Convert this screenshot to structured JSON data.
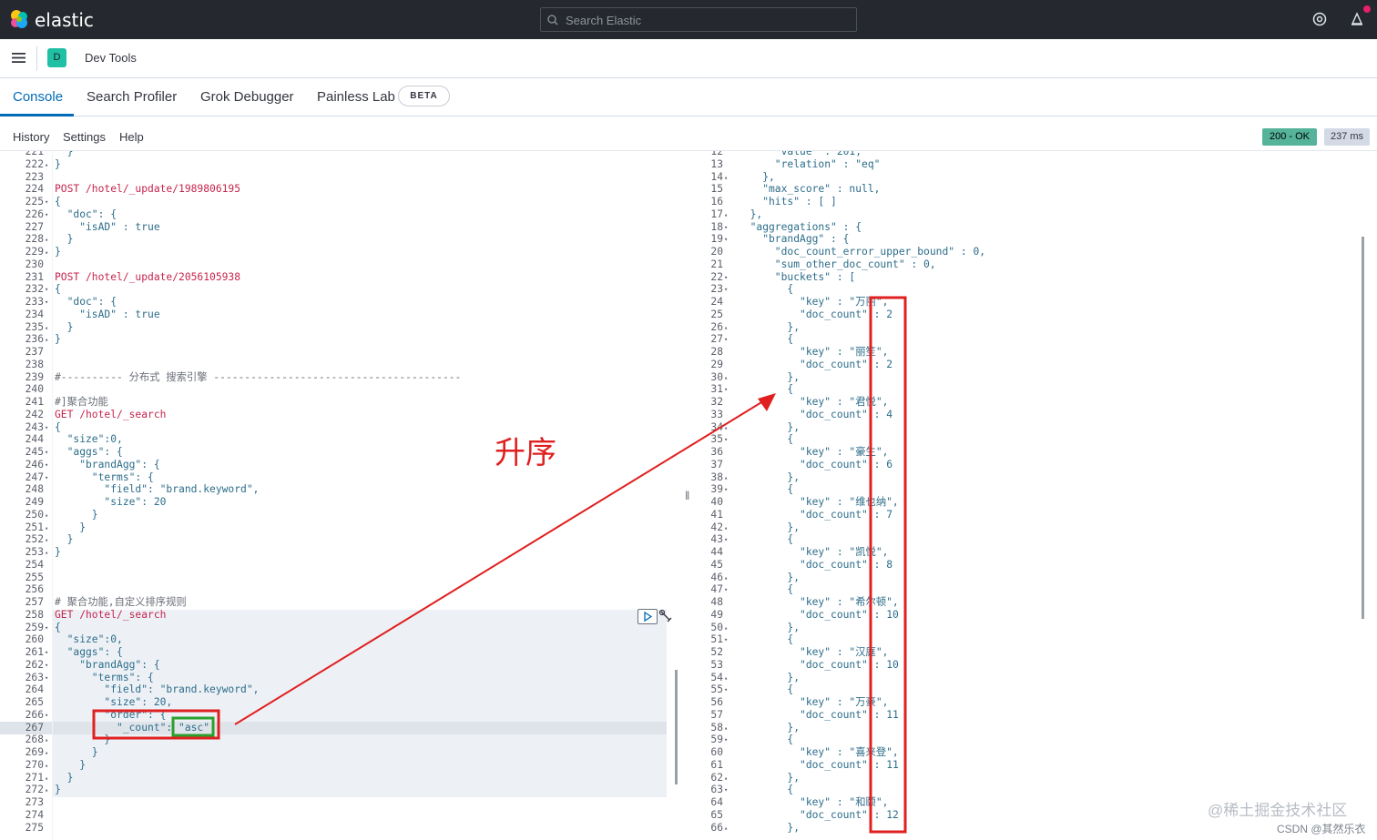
{
  "header": {
    "brand": "elastic",
    "search_placeholder": "Search Elastic"
  },
  "breadcrumb": {
    "space_initial": "D",
    "title": "Dev Tools"
  },
  "tabs": [
    {
      "label": "Console"
    },
    {
      "label": "Search Profiler"
    },
    {
      "label": "Grok Debugger"
    },
    {
      "label": "Painless Lab"
    }
  ],
  "beta": "BETA",
  "subnav": {
    "history": "History",
    "settings": "Settings",
    "help": "Help"
  },
  "response": {
    "status": "200 - OK",
    "time": "237 ms"
  },
  "annotation": {
    "text": "升序"
  },
  "watermark": {
    "main": "@稀土掘金技术社区",
    "sub": "CSDN @其然乐衣"
  },
  "colors": {
    "topbar": "#25282f",
    "accent": "#006bb8",
    "status_ok": "#54b399",
    "annotation_red": "#e02020",
    "annotation_green": "#2ca02c"
  },
  "editor": {
    "lines": [
      {
        "n": "221",
        "f": "",
        "t": "  }"
      },
      {
        "n": "222",
        "f": "▴",
        "t": "}"
      },
      {
        "n": "223",
        "f": "",
        "t": ""
      },
      {
        "n": "224",
        "f": "",
        "t": "POST /hotel/_update/1989806195"
      },
      {
        "n": "225",
        "f": "▾",
        "t": "{"
      },
      {
        "n": "226",
        "f": "▾",
        "t": "  \"doc\": {"
      },
      {
        "n": "227",
        "f": "",
        "t": "    \"isAD\" : true"
      },
      {
        "n": "228",
        "f": "▴",
        "t": "  }"
      },
      {
        "n": "229",
        "f": "▴",
        "t": "}"
      },
      {
        "n": "230",
        "f": "",
        "t": ""
      },
      {
        "n": "231",
        "f": "",
        "t": "POST /hotel/_update/2056105938"
      },
      {
        "n": "232",
        "f": "▾",
        "t": "{"
      },
      {
        "n": "233",
        "f": "▾",
        "t": "  \"doc\": {"
      },
      {
        "n": "234",
        "f": "",
        "t": "    \"isAD\" : true"
      },
      {
        "n": "235",
        "f": "▴",
        "t": "  }"
      },
      {
        "n": "236",
        "f": "▴",
        "t": "}"
      },
      {
        "n": "237",
        "f": "",
        "t": ""
      },
      {
        "n": "238",
        "f": "",
        "t": ""
      },
      {
        "n": "239",
        "f": "",
        "t": "#---------- 分布式 搜索引擎 ----------------------------------------"
      },
      {
        "n": "240",
        "f": "",
        "t": ""
      },
      {
        "n": "241",
        "f": "",
        "t": "#]聚合功能"
      },
      {
        "n": "242",
        "f": "",
        "t": "GET /hotel/_search"
      },
      {
        "n": "243",
        "f": "▾",
        "t": "{"
      },
      {
        "n": "244",
        "f": "",
        "t": "  \"size\":0,"
      },
      {
        "n": "245",
        "f": "▾",
        "t": "  \"aggs\": {"
      },
      {
        "n": "246",
        "f": "▾",
        "t": "    \"brandAgg\": {"
      },
      {
        "n": "247",
        "f": "▾",
        "t": "      \"terms\": {"
      },
      {
        "n": "248",
        "f": "",
        "t": "        \"field\": \"brand.keyword\","
      },
      {
        "n": "249",
        "f": "",
        "t": "        \"size\": 20"
      },
      {
        "n": "250",
        "f": "▴",
        "t": "      }"
      },
      {
        "n": "251",
        "f": "▴",
        "t": "    }"
      },
      {
        "n": "252",
        "f": "▴",
        "t": "  }"
      },
      {
        "n": "253",
        "f": "▴",
        "t": "}"
      },
      {
        "n": "254",
        "f": "",
        "t": ""
      },
      {
        "n": "255",
        "f": "",
        "t": ""
      },
      {
        "n": "256",
        "f": "",
        "t": ""
      },
      {
        "n": "257",
        "f": "",
        "t": "# 聚合功能,自定义排序规则"
      },
      {
        "n": "258",
        "f": "",
        "t": "GET /hotel/_search"
      },
      {
        "n": "259",
        "f": "▾",
        "t": "{"
      },
      {
        "n": "260",
        "f": "",
        "t": "  \"size\":0,"
      },
      {
        "n": "261",
        "f": "▾",
        "t": "  \"aggs\": {"
      },
      {
        "n": "262",
        "f": "▾",
        "t": "    \"brandAgg\": {"
      },
      {
        "n": "263",
        "f": "▾",
        "t": "      \"terms\": {"
      },
      {
        "n": "264",
        "f": "",
        "t": "        \"field\": \"brand.keyword\","
      },
      {
        "n": "265",
        "f": "",
        "t": "        \"size\": 20,"
      },
      {
        "n": "266",
        "f": "▾",
        "t": "        \"order\": {"
      },
      {
        "n": "267",
        "f": "",
        "t": "          \"_count\": \"asc\""
      },
      {
        "n": "268",
        "f": "▴",
        "t": "        }"
      },
      {
        "n": "269",
        "f": "▴",
        "t": "      }"
      },
      {
        "n": "270",
        "f": "▴",
        "t": "    }"
      },
      {
        "n": "271",
        "f": "▴",
        "t": "  }"
      },
      {
        "n": "272",
        "f": "▴",
        "t": "}"
      },
      {
        "n": "273",
        "f": "",
        "t": ""
      },
      {
        "n": "274",
        "f": "",
        "t": ""
      },
      {
        "n": "275",
        "f": "",
        "t": ""
      }
    ]
  },
  "output": {
    "lines": [
      {
        "n": "12",
        "f": "",
        "t": "      \"value\" : 201,"
      },
      {
        "n": "13",
        "f": "",
        "t": "      \"relation\" : \"eq\""
      },
      {
        "n": "14",
        "f": "▴",
        "t": "    },"
      },
      {
        "n": "15",
        "f": "",
        "t": "    \"max_score\" : null,"
      },
      {
        "n": "16",
        "f": "",
        "t": "    \"hits\" : [ ]"
      },
      {
        "n": "17",
        "f": "▴",
        "t": "  },"
      },
      {
        "n": "18",
        "f": "▾",
        "t": "  \"aggregations\" : {"
      },
      {
        "n": "19",
        "f": "▾",
        "t": "    \"brandAgg\" : {"
      },
      {
        "n": "20",
        "f": "",
        "t": "      \"doc_count_error_upper_bound\" : 0,"
      },
      {
        "n": "21",
        "f": "",
        "t": "      \"sum_other_doc_count\" : 0,"
      },
      {
        "n": "22",
        "f": "▾",
        "t": "      \"buckets\" : ["
      },
      {
        "n": "23",
        "f": "▾",
        "t": "        {"
      },
      {
        "n": "24",
        "f": "",
        "t": "          \"key\" : \"万丽\","
      },
      {
        "n": "25",
        "f": "",
        "t": "          \"doc_count\" : 2"
      },
      {
        "n": "26",
        "f": "▴",
        "t": "        },"
      },
      {
        "n": "27",
        "f": "▾",
        "t": "        {"
      },
      {
        "n": "28",
        "f": "",
        "t": "          \"key\" : \"丽笙\","
      },
      {
        "n": "29",
        "f": "",
        "t": "          \"doc_count\" : 2"
      },
      {
        "n": "30",
        "f": "▴",
        "t": "        },"
      },
      {
        "n": "31",
        "f": "▾",
        "t": "        {"
      },
      {
        "n": "32",
        "f": "",
        "t": "          \"key\" : \"君悦\","
      },
      {
        "n": "33",
        "f": "",
        "t": "          \"doc_count\" : 4"
      },
      {
        "n": "34",
        "f": "▴",
        "t": "        },"
      },
      {
        "n": "35",
        "f": "▾",
        "t": "        {"
      },
      {
        "n": "36",
        "f": "",
        "t": "          \"key\" : \"豪生\","
      },
      {
        "n": "37",
        "f": "",
        "t": "          \"doc_count\" : 6"
      },
      {
        "n": "38",
        "f": "▴",
        "t": "        },"
      },
      {
        "n": "39",
        "f": "▾",
        "t": "        {"
      },
      {
        "n": "40",
        "f": "",
        "t": "          \"key\" : \"维也纳\","
      },
      {
        "n": "41",
        "f": "",
        "t": "          \"doc_count\" : 7"
      },
      {
        "n": "42",
        "f": "▴",
        "t": "        },"
      },
      {
        "n": "43",
        "f": "▾",
        "t": "        {"
      },
      {
        "n": "44",
        "f": "",
        "t": "          \"key\" : \"凯悦\","
      },
      {
        "n": "45",
        "f": "",
        "t": "          \"doc_count\" : 8"
      },
      {
        "n": "46",
        "f": "▴",
        "t": "        },"
      },
      {
        "n": "47",
        "f": "▾",
        "t": "        {"
      },
      {
        "n": "48",
        "f": "",
        "t": "          \"key\" : \"希尔顿\","
      },
      {
        "n": "49",
        "f": "",
        "t": "          \"doc_count\" : 10"
      },
      {
        "n": "50",
        "f": "▴",
        "t": "        },"
      },
      {
        "n": "51",
        "f": "▾",
        "t": "        {"
      },
      {
        "n": "52",
        "f": "",
        "t": "          \"key\" : \"汉庭\","
      },
      {
        "n": "53",
        "f": "",
        "t": "          \"doc_count\" : 10"
      },
      {
        "n": "54",
        "f": "▴",
        "t": "        },"
      },
      {
        "n": "55",
        "f": "▾",
        "t": "        {"
      },
      {
        "n": "56",
        "f": "",
        "t": "          \"key\" : \"万豪\","
      },
      {
        "n": "57",
        "f": "",
        "t": "          \"doc_count\" : 11"
      },
      {
        "n": "58",
        "f": "▴",
        "t": "        },"
      },
      {
        "n": "59",
        "f": "▾",
        "t": "        {"
      },
      {
        "n": "60",
        "f": "",
        "t": "          \"key\" : \"喜来登\","
      },
      {
        "n": "61",
        "f": "",
        "t": "          \"doc_count\" : 11"
      },
      {
        "n": "62",
        "f": "▴",
        "t": "        },"
      },
      {
        "n": "63",
        "f": "▾",
        "t": "        {"
      },
      {
        "n": "64",
        "f": "",
        "t": "          \"key\" : \"和颐\","
      },
      {
        "n": "65",
        "f": "",
        "t": "          \"doc_count\" : 12"
      },
      {
        "n": "66",
        "f": "▴",
        "t": "        },"
      }
    ]
  }
}
